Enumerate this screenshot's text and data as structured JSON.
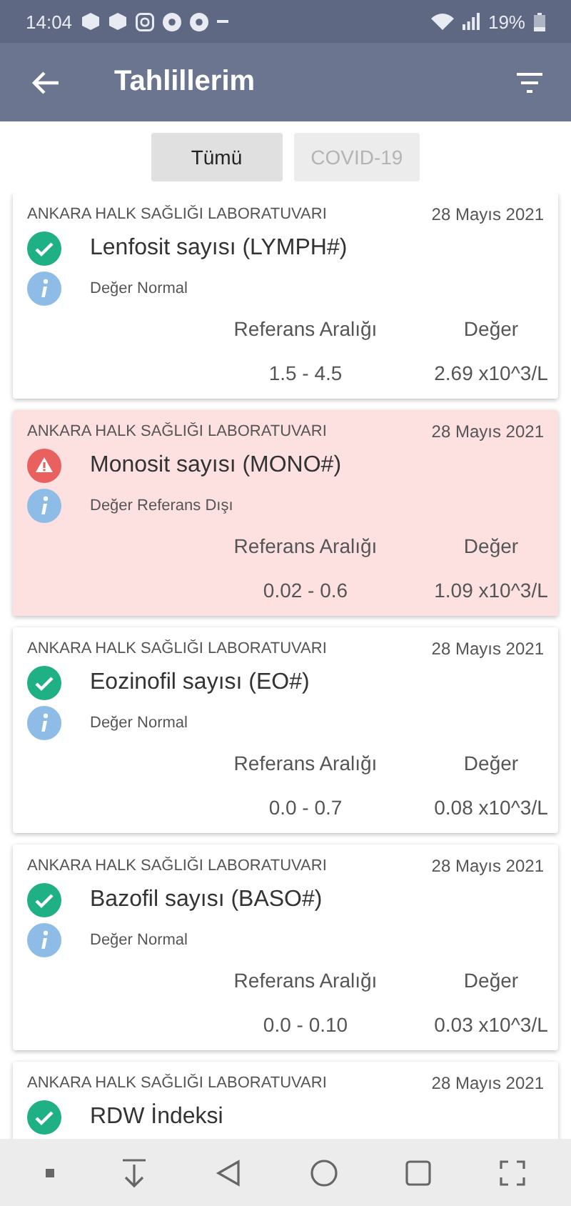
{
  "status_bar": {
    "time": "14:04",
    "battery": "19%"
  },
  "header": {
    "title": "Tahlillerim"
  },
  "filters": [
    {
      "label": "Tümü",
      "selected": true
    },
    {
      "label": "COVID-19",
      "selected": false
    }
  ],
  "results": [
    {
      "lab": "ANKARA HALK SAĞLIĞI LABORATUVARI",
      "date": "28 Mayıs 2021",
      "name": "Lenfosit sayısı (LYMPH#)",
      "kind": "normal",
      "status_text": "Değer Normal",
      "range_label": "Referans Aralığı",
      "value_label": "Değer",
      "range": "1.5 - 4.5",
      "value": "2.69 x10^3/L"
    },
    {
      "lab": "ANKARA HALK SAĞLIĞI LABORATUVARI",
      "date": "28 Mayıs 2021",
      "name": "Monosit sayısı (MONO#)",
      "kind": "abnormal",
      "status_text": "Değer Referans Dışı",
      "range_label": "Referans Aralığı",
      "value_label": "Değer",
      "range": "0.02 - 0.6",
      "value": "1.09 x10^3/L"
    },
    {
      "lab": "ANKARA HALK SAĞLIĞI LABORATUVARI",
      "date": "28 Mayıs 2021",
      "name": "Eozinofil sayısı (EO#)",
      "kind": "normal",
      "status_text": "Değer Normal",
      "range_label": "Referans Aralığı",
      "value_label": "Değer",
      "range": "0.0 - 0.7",
      "value": "0.08 x10^3/L"
    },
    {
      "lab": "ANKARA HALK SAĞLIĞI LABORATUVARI",
      "date": "28 Mayıs 2021",
      "name": "Bazofil sayısı (BASO#)",
      "kind": "normal",
      "status_text": "Değer Normal",
      "range_label": "Referans Aralığı",
      "value_label": "Değer",
      "range": "0.0 - 0.10",
      "value": "0.03 x10^3/L"
    },
    {
      "lab": "ANKARA HALK SAĞLIĞI LABORATUVARI",
      "date": "28 Mayıs 2021",
      "name": "RDW İndeksi",
      "kind": "normal"
    }
  ]
}
